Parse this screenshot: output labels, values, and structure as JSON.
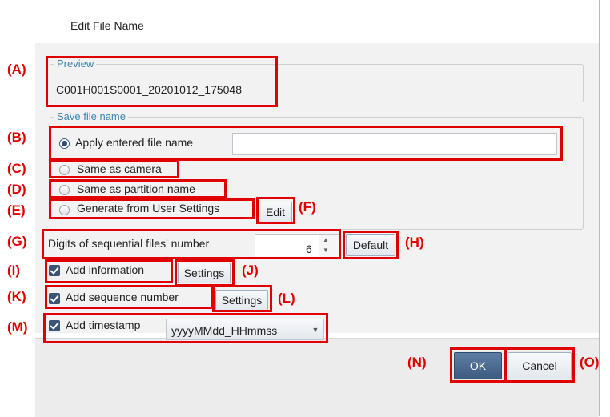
{
  "dialog": {
    "title": "Edit File Name"
  },
  "preview": {
    "legend": "Preview",
    "value": "C001H001S0001_20201012_175048"
  },
  "save_file_name": {
    "legend": "Save file name",
    "options": [
      {
        "label": "Apply entered file name",
        "selected": true
      },
      {
        "label": "Same as camera",
        "selected": false
      },
      {
        "label": "Same as partition name",
        "selected": false
      },
      {
        "label": "Generate from User Settings",
        "selected": false
      }
    ],
    "entered_name_value": "",
    "edit_button": "Edit"
  },
  "digits": {
    "label": "Digits of sequential files' number",
    "value": "6",
    "default_button": "Default"
  },
  "add_information": {
    "label": "Add information",
    "checked": true,
    "settings_button": "Settings"
  },
  "add_sequence": {
    "label": "Add sequence number",
    "checked": true,
    "settings_button": "Settings"
  },
  "add_timestamp": {
    "label": "Add timestamp",
    "checked": true,
    "format": "yyyyMMdd_HHmmss"
  },
  "footer": {
    "ok": "OK",
    "cancel": "Cancel"
  },
  "annotations": {
    "A": "(A)",
    "B": "(B)",
    "C": "(C)",
    "D": "(D)",
    "E": "(E)",
    "F": "(F)",
    "G": "(G)",
    "H": "(H)",
    "I": "(I)",
    "J": "(J)",
    "K": "(K)",
    "L": "(L)",
    "M": "(M)",
    "N": "(N)",
    "O": "(O)"
  },
  "colors": {
    "highlight": "#e00000",
    "accent": "#3a5478",
    "legend": "#3d86b0"
  }
}
